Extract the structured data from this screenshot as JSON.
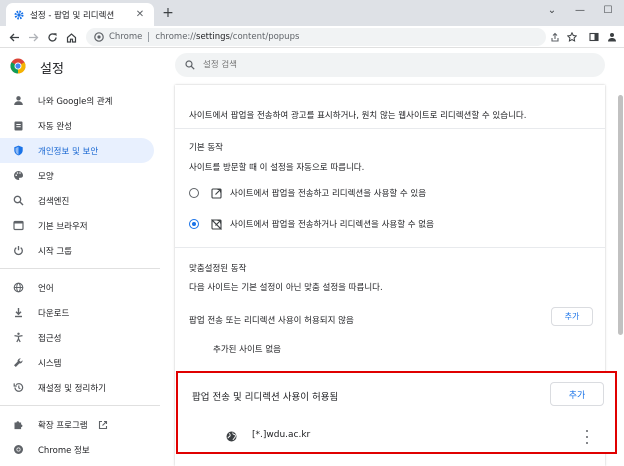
{
  "tab": {
    "title": "설정 - 팝업 및 리디렉션",
    "close": "✕",
    "new_tab": "+"
  },
  "window_controls": {
    "chevron": "⌄",
    "minimize": "—",
    "maximize": "☐"
  },
  "omnibox": {
    "site_chip": "Chrome",
    "url_scheme": "chrome://",
    "url_host": "settings",
    "url_path": "/content/popups"
  },
  "header": {
    "title": "설정",
    "search_placeholder": "설정 검색"
  },
  "sidebar": {
    "items": [
      {
        "label": "나와 Google의 관계",
        "icon": "person-icon"
      },
      {
        "label": "자동 완성",
        "icon": "clipboard-icon"
      },
      {
        "label": "개인정보 및 보안",
        "icon": "shield-icon",
        "active": true
      },
      {
        "label": "모양",
        "icon": "palette-icon"
      },
      {
        "label": "검색엔진",
        "icon": "search-icon"
      },
      {
        "label": "기본 브라우저",
        "icon": "browser-icon"
      },
      {
        "label": "시작 그룹",
        "icon": "power-icon"
      },
      {
        "label": "언어",
        "icon": "globe-icon"
      },
      {
        "label": "다운로드",
        "icon": "download-icon"
      },
      {
        "label": "접근성",
        "icon": "accessibility-icon"
      },
      {
        "label": "시스템",
        "icon": "wrench-icon"
      },
      {
        "label": "재설정 및 정리하기",
        "icon": "history-icon"
      },
      {
        "label": "확장 프로그램",
        "icon": "puzzle-icon"
      },
      {
        "label": "Chrome 정보",
        "icon": "chrome-icon"
      }
    ]
  },
  "content": {
    "description": "사이트에서 팝업을 전송하여 광고를 표시하거나, 원치 않는 웹사이트로 리디렉션할 수 있습니다.",
    "default_heading": "기본 동작",
    "default_sub": "사이트를 방문할 때 이 설정을 자동으로 따릅니다.",
    "option_allow": "사이트에서 팝업을 전송하고 리디렉션을 사용할 수 있음",
    "option_block": "사이트에서 팝업을 전송하거나 리디렉션을 사용할 수 없음",
    "custom_heading": "맞춤설정된 동작",
    "custom_sub": "다음 사이트는 기본 설정이 아닌 맞춤 설정을 따릅니다.",
    "blocked_heading": "팝업 전송 또는 리디렉션 사용이 허용되지 않음",
    "add_label": "추가",
    "no_sites": "추가된 사이트 없음"
  },
  "allowed": {
    "heading": "팝업 전송 및 리디렉션 사용이 허용됨",
    "add_label": "추가",
    "site": "[*.]wdu.ac.kr"
  },
  "colors": {
    "accent": "#1a73e8",
    "highlight_border": "#e00000",
    "active_bg": "#e8f0fe"
  }
}
